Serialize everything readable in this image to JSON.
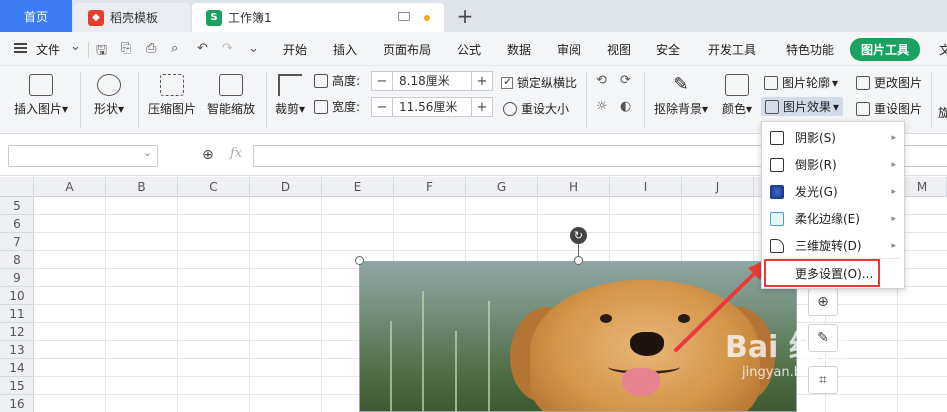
{
  "tabs": {
    "home": "首页",
    "template": "稻壳模板",
    "workbook": "工作簿1",
    "new": "+"
  },
  "menubar": {
    "file": "文件",
    "items": [
      "开始",
      "插入",
      "页面布局",
      "公式",
      "数据",
      "审阅",
      "视图",
      "安全",
      "开发工具",
      "特色功能",
      "图片工具",
      "文"
    ]
  },
  "ribbon": {
    "insert_picture": "插入图片",
    "shape": "形状",
    "compress_picture": "压缩图片",
    "smart_scale": "智能缩放",
    "crop": "裁剪",
    "height_label": "高度:",
    "height_value": "8.18厘米",
    "width_label": "宽度:",
    "width_value": "11.56厘米",
    "lock_ratio": "锁定纵横比",
    "reset_size": "重设大小",
    "remove_bg": "抠除背景",
    "color": "颜色",
    "picture_outline": "图片轮廓",
    "picture_effect": "图片效果",
    "change_picture": "更改图片",
    "reset_picture": "重设图片",
    "rotate": "旋"
  },
  "formula_bar": {
    "fx": "fx",
    "name_value": "",
    "formula_value": ""
  },
  "grid": {
    "columns": [
      "A",
      "B",
      "C",
      "D",
      "E",
      "F",
      "G",
      "H",
      "I",
      "J",
      "K",
      "L",
      "M"
    ],
    "rows": [
      "5",
      "6",
      "7",
      "8",
      "9",
      "10",
      "11",
      "12",
      "13",
      "14",
      "15",
      "16"
    ]
  },
  "dropdown": {
    "items": [
      {
        "label": "阴影(S)",
        "icon": "shadow-icon"
      },
      {
        "label": "倒影(R)",
        "icon": "reflection-icon"
      },
      {
        "label": "发光(G)",
        "icon": "glow-icon"
      },
      {
        "label": "柔化边缘(E)",
        "icon": "soft-edge-icon"
      },
      {
        "label": "三维旋转(D)",
        "icon": "3d-rotation-icon"
      }
    ],
    "more": "更多设置(O)..."
  },
  "watermark": {
    "main": "Bai 经验",
    "sub": "jingyan.baidu.com"
  },
  "colors": {
    "accent_green": "#1aa260",
    "home_blue": "#3d7df5",
    "highlight_red": "#e83a3a"
  }
}
